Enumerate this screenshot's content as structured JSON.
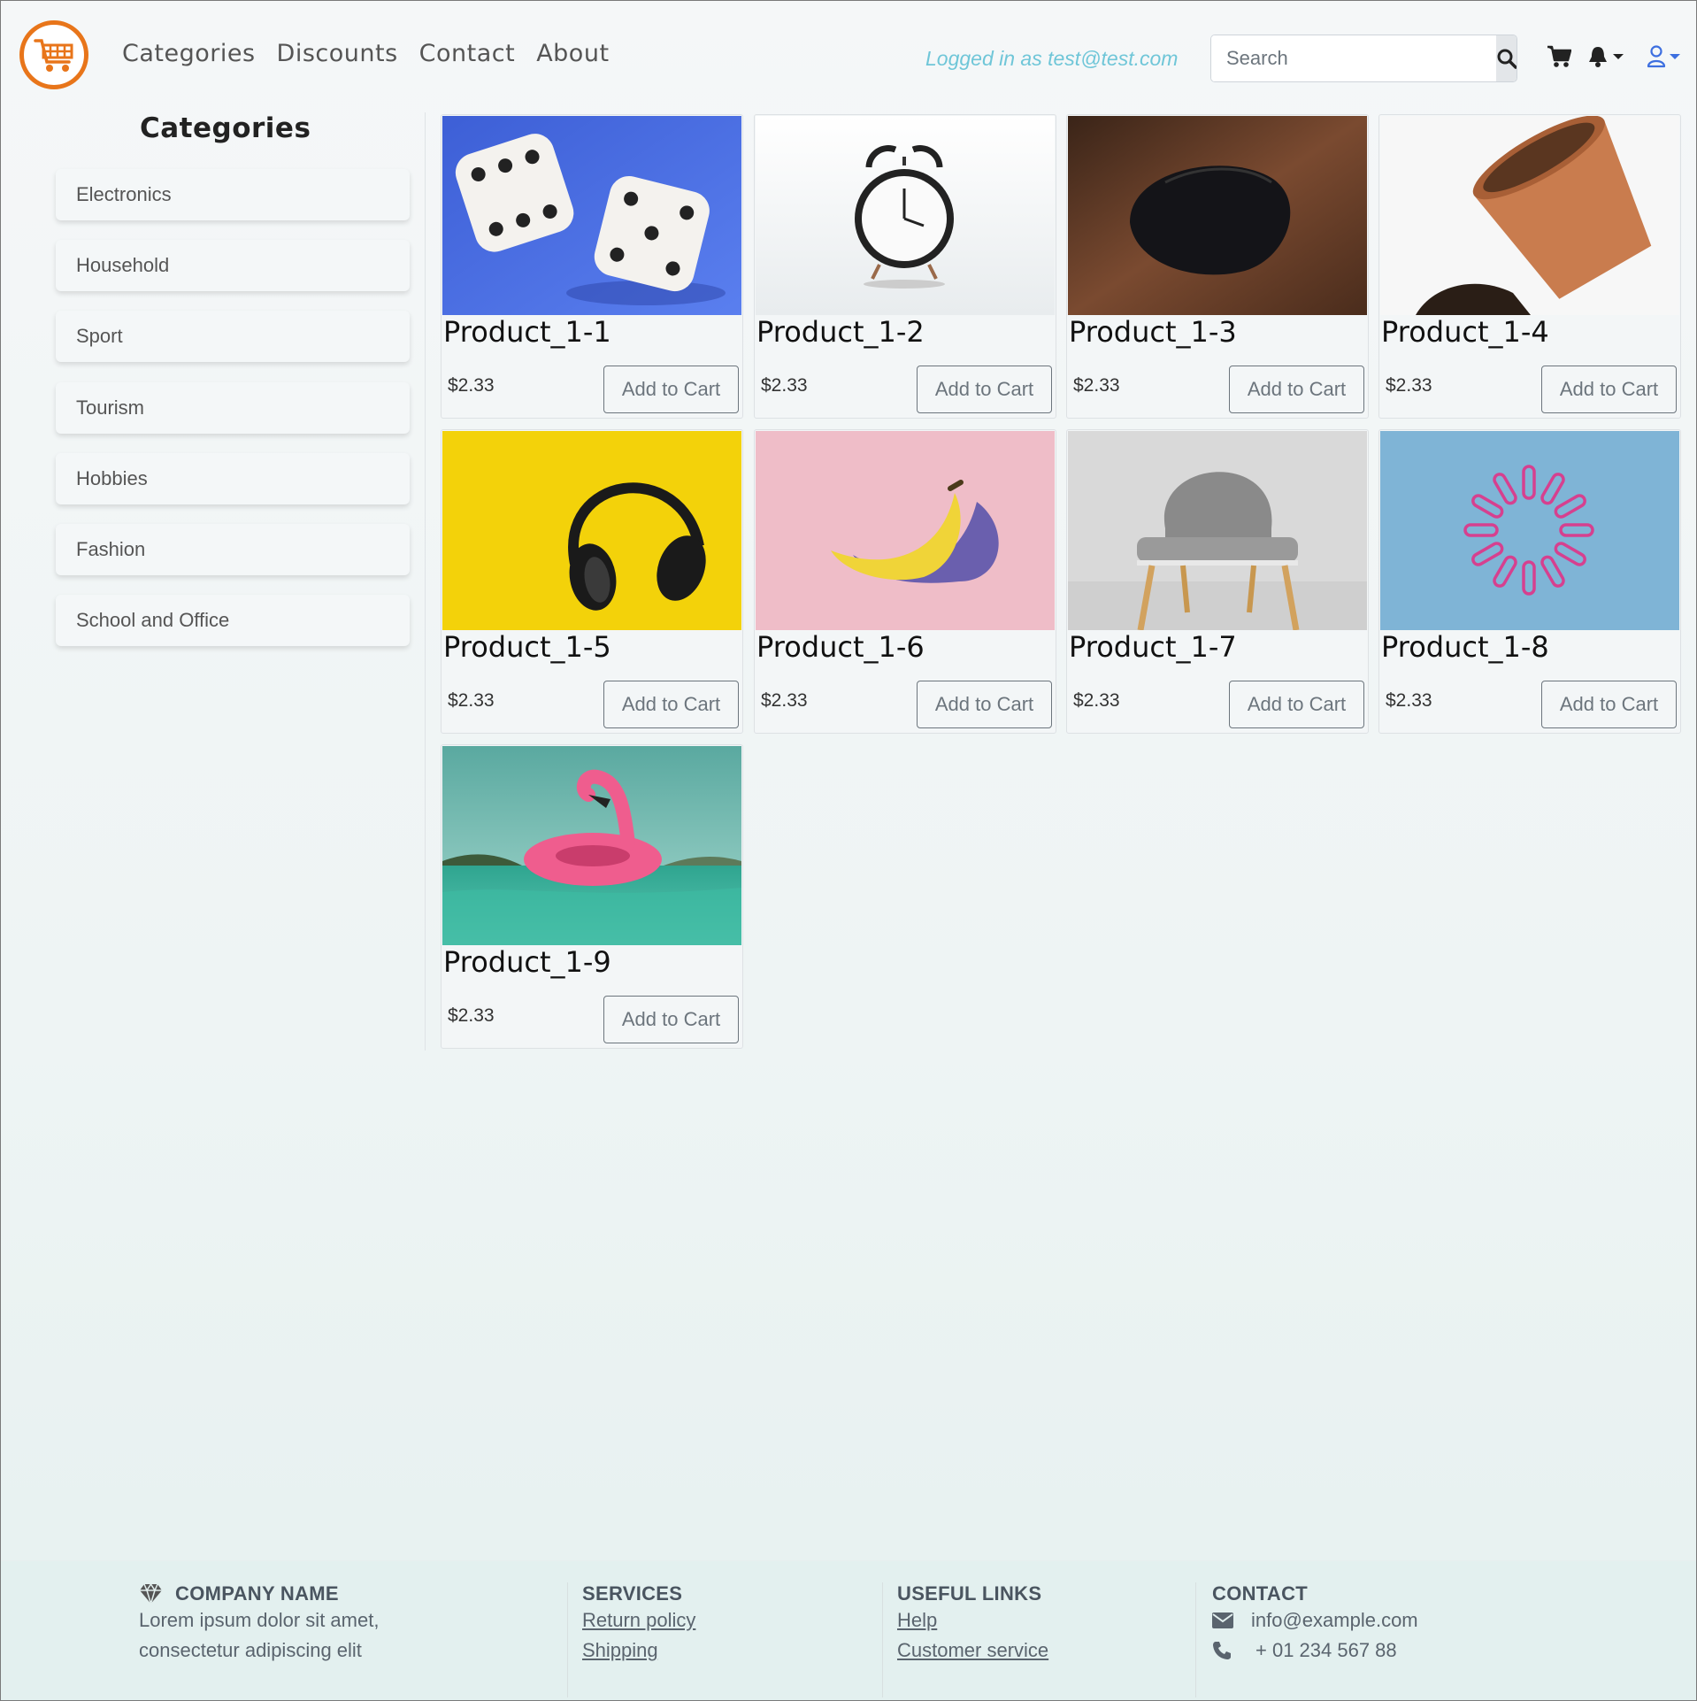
{
  "nav": {
    "links": [
      "Categories",
      "Discounts",
      "Contact",
      "About"
    ],
    "logged_in": "Logged in as test@test.com",
    "search_placeholder": "Search"
  },
  "sidebar": {
    "title": "Categories",
    "items": [
      "Electronics",
      "Household",
      "Sport",
      "Tourism",
      "Hobbies",
      "Fashion",
      "School and Office"
    ]
  },
  "products": [
    {
      "name": "Product_1-1",
      "price": "$2.33",
      "button": "Add to Cart",
      "image": "dice"
    },
    {
      "name": "Product_1-2",
      "price": "$2.33",
      "button": "Add to Cart",
      "image": "alarm-clock"
    },
    {
      "name": "Product_1-3",
      "price": "$2.33",
      "button": "Add to Cart",
      "image": "computer-mouse"
    },
    {
      "name": "Product_1-4",
      "price": "$2.33",
      "button": "Add to Cart",
      "image": "flower-pot"
    },
    {
      "name": "Product_1-5",
      "price": "$2.33",
      "button": "Add to Cart",
      "image": "headphones"
    },
    {
      "name": "Product_1-6",
      "price": "$2.33",
      "button": "Add to Cart",
      "image": "banana"
    },
    {
      "name": "Product_1-7",
      "price": "$2.33",
      "button": "Add to Cart",
      "image": "chair"
    },
    {
      "name": "Product_1-8",
      "price": "$2.33",
      "button": "Add to Cart",
      "image": "paper-clips"
    },
    {
      "name": "Product_1-9",
      "price": "$2.33",
      "button": "Add to Cart",
      "image": "flamingo-float"
    }
  ],
  "footer": {
    "company": {
      "title": "COMPANY NAME",
      "text1": "Lorem ipsum dolor sit amet,",
      "text2": "consectetur adipiscing elit"
    },
    "services": {
      "title": "SERVICES",
      "links": [
        "Return policy",
        "Shipping"
      ]
    },
    "useful": {
      "title": "USEFUL LINKS",
      "links": [
        "Help",
        "Customer service"
      ]
    },
    "contact": {
      "title": "CONTACT",
      "email": "info@example.com",
      "phone": "+ 01 234 567 88"
    }
  },
  "colors": {
    "brand": "#e8751a",
    "user_icon": "#3d6fe0",
    "logged_in_text": "#6fc6d8"
  }
}
